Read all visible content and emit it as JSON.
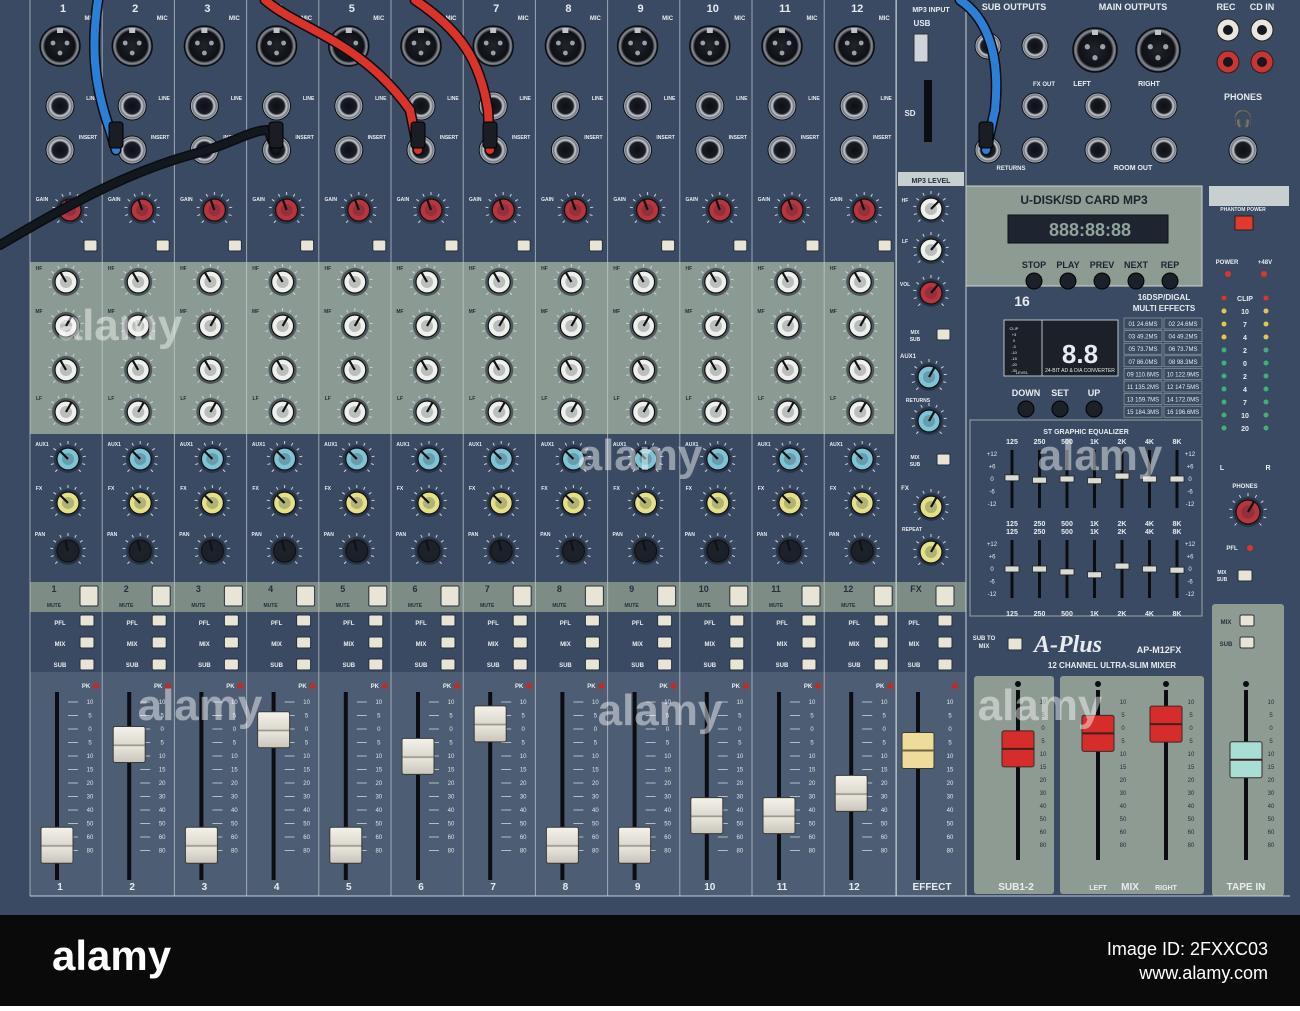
{
  "brand": {
    "name": "A-Plus",
    "model": "AP-M12FX",
    "subtitle": "12 CHANNEL ULTRA-SLIM MIXER"
  },
  "channels": [
    {
      "num": "1",
      "fader": 0.1
    },
    {
      "num": "2",
      "fader": 0.78
    },
    {
      "num": "3",
      "fader": 0.1
    },
    {
      "num": "4",
      "fader": 0.88
    },
    {
      "num": "5",
      "fader": 0.1
    },
    {
      "num": "6",
      "fader": 0.7
    },
    {
      "num": "7",
      "fader": 0.92
    },
    {
      "num": "8",
      "fader": 0.1
    },
    {
      "num": "9",
      "fader": 0.1
    },
    {
      "num": "10",
      "fader": 0.3
    },
    {
      "num": "11",
      "fader": 0.3
    },
    {
      "num": "12",
      "fader": 0.45
    }
  ],
  "effect_fader": 0.74,
  "master_faders": [
    {
      "name": "sub1",
      "level": 0.62,
      "color": "#d62c2c"
    },
    {
      "name": "sub2",
      "level": 0.62,
      "color": "#d62c2c"
    },
    {
      "name": "left",
      "level": 0.72,
      "color": "#d62c2c"
    },
    {
      "name": "right",
      "level": 0.78,
      "color": "#d62c2c"
    },
    {
      "name": "tape",
      "level": 0.55,
      "color": "#a8ded6"
    }
  ],
  "labels": {
    "mic": "MIC",
    "line": "LINE",
    "insert": "INSERT",
    "gain": "GAIN",
    "hf": "HF",
    "mf": "MF",
    "lf": "LF",
    "aux1": "AUX1",
    "fx": "FX",
    "pan": "PAN",
    "mute": "MUTE",
    "pfl": "PFL",
    "mix": "MIX",
    "sub": "SUB",
    "pk": "PK",
    "mp3_input": "MP3 INPUT",
    "usb": "USB",
    "sd": "SD",
    "mp3_level": "MP3 LEVEL",
    "vol": "VOL",
    "sub_outputs": "SUB OUTPUTS",
    "main_outputs": "MAIN OUTPUTS",
    "rec": "REC",
    "cd_in": "CD IN",
    "phones": "PHONES",
    "phantom": "PHANTOM POWER",
    "fx_out": "FX OUT",
    "returns": "RETURNS",
    "room_out": "ROOM OUT",
    "left": "LEFT",
    "right": "RIGHT",
    "power": "POWER",
    "v48": "+48V",
    "clip": "CLIP",
    "aux1_returns": "RETURNS",
    "repeat": "REPEAT",
    "effect": "EFFECT",
    "sub12": "SUB1-2",
    "mix_big": "MIX",
    "tape_in": "TAPE IN",
    "sub_to_mix": "SUB TO MIX",
    "pfl_side": "PFL"
  },
  "mp3": {
    "title": "U-DISK/SD CARD MP3",
    "display": "888:88:88",
    "buttons": [
      "STOP",
      "PLAY",
      "PREV",
      "NEXT",
      "REP"
    ]
  },
  "dsp": {
    "title": "16DSP/DIGAL MULTI EFFECTS",
    "logo": "16",
    "display": "8.8",
    "converter": "24-BIT AD & D/A CONVERTER",
    "buttons": [
      "DOWN",
      "SET",
      "UP"
    ],
    "presets": [
      [
        "01 24.6MS",
        "02 24.6MS"
      ],
      [
        "03 49.2MS",
        "04 49.2MS"
      ],
      [
        "05 73.7MS",
        "06 73.7MS"
      ],
      [
        "07 86.0MS",
        "08 98.3MS"
      ],
      [
        "09 110.6MS",
        "10 122.9MS"
      ],
      [
        "11 135.2MS",
        "12 147.5MS"
      ],
      [
        "13 159.7MS",
        "14 172.0MS"
      ],
      [
        "15 184.3MS",
        "16 196.6MS"
      ]
    ],
    "levels": [
      "CLIP",
      "+3",
      "0",
      "-3",
      "-10",
      "-15",
      "-20",
      "-30"
    ],
    "level_label": "LEVEL"
  },
  "eq": {
    "title": "ST GRAPHIC EQUALIZER",
    "bands": [
      "125",
      "250",
      "500",
      "1K",
      "2K",
      "4K",
      "8K"
    ],
    "scale": [
      "+12",
      "+6",
      "0",
      "-6",
      "-12"
    ],
    "eq1": [
      0.52,
      0.48,
      0.5,
      0.47,
      0.55,
      0.5,
      0.5
    ],
    "eq2": [
      0.5,
      0.5,
      0.45,
      0.4,
      0.55,
      0.5,
      0.48
    ]
  },
  "meter_scale": [
    "CLIP",
    "10",
    "7",
    "4",
    "2",
    "0",
    "2",
    "4",
    "7",
    "10",
    "20"
  ],
  "meter_lr": [
    "L",
    "R"
  ],
  "fader_scale": [
    "10",
    "5",
    "0",
    "5",
    "10",
    "15",
    "20",
    "30",
    "40",
    "50",
    "60",
    "80"
  ],
  "watermark": "alamy",
  "footer": {
    "logo": "alamy",
    "image_id": "Image ID: 2FXXC03",
    "url": "www.alamy.com"
  }
}
